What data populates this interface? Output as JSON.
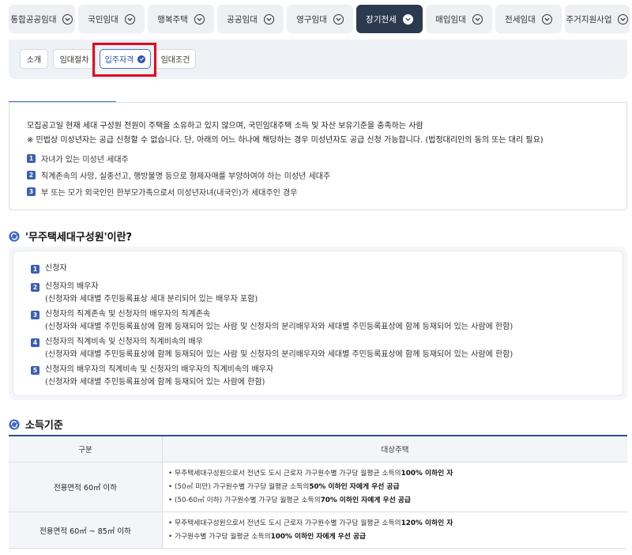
{
  "top_tabs": [
    {
      "label": "통합공공임대"
    },
    {
      "label": "국민임대"
    },
    {
      "label": "행복주택"
    },
    {
      "label": "공공임대"
    },
    {
      "label": "영구임대"
    },
    {
      "label": "장기전세"
    },
    {
      "label": "매입임대"
    },
    {
      "label": "전세임대"
    },
    {
      "label": "주거지원사업"
    }
  ],
  "active_top_tab": "장기전세",
  "sub_tabs": [
    {
      "label": "소개"
    },
    {
      "label": "임대절차"
    },
    {
      "label": "입주자격"
    },
    {
      "label": "임대조건"
    }
  ],
  "active_sub_tab": "입주자격",
  "eligibility": {
    "lead": "모집공고일 현재 세대 구성원 전원이 주택을 소유하고 있지 않으며, 국민임대주택 소득 및 자산 보유기준을 충족하는 사람",
    "note": "※  민법상 미성년자는 공급 신청할 수 없습니다. 단, 아래의 어느 하나에 해당하는 경우 미성년자도 공급 신청 가능합니다. (법정대리인의 동의 또는 대리 필요)",
    "items": [
      {
        "num": "1",
        "text": "자녀가 있는 미성년 세대주"
      },
      {
        "num": "2",
        "text": "직계존속의 사망, 실종선고, 행방불명 등으로 형제자매를 부양하여야 하는 미성년 세대주"
      },
      {
        "num": "3",
        "text": "부 또는 모가 외국인인 한부모가족으로서 미성년자녀(내국인)가 세대주인 경우"
      }
    ]
  },
  "members_section": {
    "title": "'무주택세대구성원'이란?",
    "items": [
      {
        "num": "1",
        "line1": "신청자",
        "line2": ""
      },
      {
        "num": "2",
        "line1": "신청자의 배우자",
        "line2": "(신청자와 세대별 주민등록표상 세대 분리되어 있는 배우자 포함)"
      },
      {
        "num": "3",
        "line1": "신청자의 직계존속 및 신청자의 배우자의 직계존속",
        "line2": "(신청자와 세대별 주민등록표상에 함께 등재되어 있는 사람 및 신청자의 분리배우자와 세대별 주민등록표상에 함께 등재되어 있는 사람에 한함)"
      },
      {
        "num": "4",
        "line1": "신청자의 직계비속 및 신청자의 직계비속의 배우",
        "line2": "(신청자와 세대별 주민등록표상에 함께 등재되어 있는 사람 및 신청자의 분리배우자와 세대별 주민등록표상에 함께 등재되어 있는 사람에 한함)"
      },
      {
        "num": "5",
        "line1": "신청자의 배우자의 직계비속 및 신청자의 배우자의 직계비속의 배우자",
        "line2": "(신청자와 세대별 주민등록표상에 함께 등재되어 있는 사람에 한함)"
      }
    ]
  },
  "income_section": {
    "title": "소득기준",
    "col1": "구분",
    "col2": "대상주택",
    "rows": [
      {
        "category": "전용면적 60㎡ 이하",
        "bullets": [
          {
            "pre": "• 무주택세대구성원으로서 전년도 도시 근로자 가구원수별 가구당 월평균 소득의 ",
            "bold": "100% 이하인 자",
            "post": ""
          },
          {
            "pre": "• (50㎡ 미만) 가구원수별 가구당 월평균 소득의 ",
            "bold": "50% 이하인 자에게 우선 공급",
            "post": ""
          },
          {
            "pre": "• (50-60㎡ 이하) 가구원수별 가구당 월평균 소득의 ",
            "bold": "70% 이하인 자에게 우선 공급",
            "post": ""
          }
        ]
      },
      {
        "category": "전용면적 60㎡ ~ 85㎡ 이하",
        "bullets": [
          {
            "pre": "• 무주택세대구성원으로서 전년도 도시 근로자 가구원수별 가구당 월평균 소득의 ",
            "bold": "120% 이하인 자",
            "post": ""
          },
          {
            "pre": "• 가구원수별 가구당 월평균 소득의 ",
            "bold": "100% 이하인 자에게 우선 공급",
            "post": ""
          }
        ]
      }
    ]
  },
  "colors": {
    "active_tab_bg": "#2b3a4e",
    "accent_blue": "#3d5fb0",
    "highlight_red": "#e3001b"
  }
}
